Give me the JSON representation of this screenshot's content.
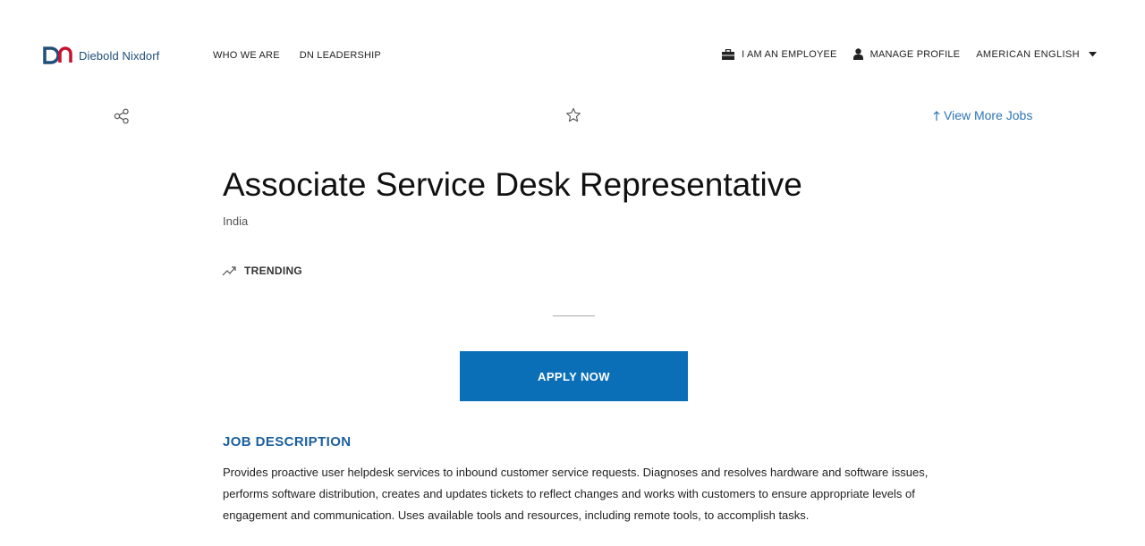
{
  "header": {
    "logo_text": "Diebold Nixdorf",
    "nav": [
      "WHO WE ARE",
      "DN LEADERSHIP"
    ],
    "employee_label": "I AM AN EMPLOYEE",
    "profile_label": "MANAGE PROFILE",
    "language_label": "AMERICAN ENGLISH"
  },
  "actions": {
    "view_more_label": "View More Jobs"
  },
  "job": {
    "title": "Associate Service Desk Representative",
    "location": "India",
    "trending_label": "TRENDING",
    "apply_label": "APPLY NOW"
  },
  "description": {
    "heading": "JOB DESCRIPTION",
    "body": "Provides proactive user helpdesk services to inbound customer service requests. Diagnoses and resolves hardware and software issues, performs software distribution, creates and updates tickets to reflect changes and works with customers to ensure appropriate levels of engagement and communication. Uses available tools and resources, including remote tools, to accomplish tasks."
  },
  "colors": {
    "brand_blue": "#1f4e79",
    "brand_red": "#c8102e",
    "apply_bg": "#0b6fb8",
    "link_blue": "#2e74b5",
    "heading_blue": "#1a5f9e"
  },
  "icons": [
    "dn-logo-icon",
    "briefcase-icon",
    "person-icon",
    "caret-down-icon",
    "share-icon",
    "star-icon",
    "arrow-up-icon",
    "trending-icon"
  ]
}
